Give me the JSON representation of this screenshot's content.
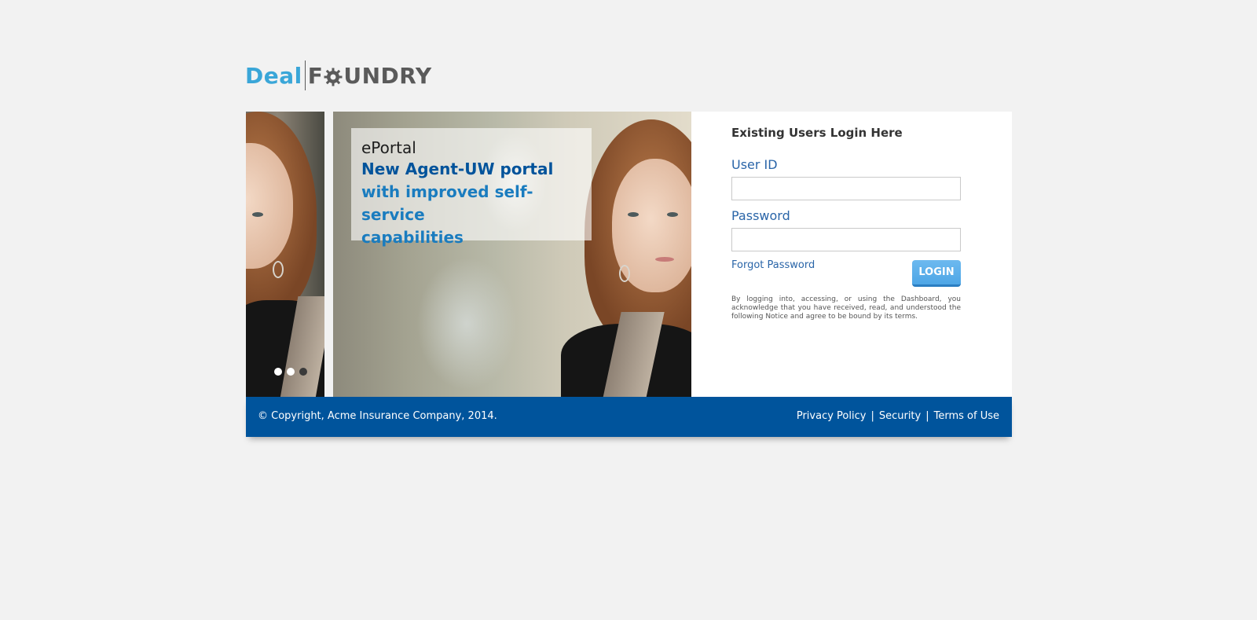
{
  "logo": {
    "part1": "Deal",
    "part2_prefix": "F",
    "part2_suffix": "UNDRY",
    "gear_icon": "gear-icon",
    "colors": {
      "deal": "#3aa6d8",
      "foundry": "#5a5a5a"
    }
  },
  "carousel": {
    "caption": {
      "title": "ePortal",
      "headline": "New Agent-UW portal",
      "subline1": "with improved self-service",
      "subline2": "capabilities"
    },
    "dots": [
      {
        "active": true
      },
      {
        "active": true
      },
      {
        "active": false
      }
    ]
  },
  "login": {
    "heading": "Existing Users Login Here",
    "user_id_label": "User ID",
    "user_id_value": "",
    "password_label": "Password",
    "password_value": "",
    "forgot_password": "Forgot Password",
    "login_button": "LOGIN",
    "notice": "By logging into, accessing, or using the Dashboard, you acknowledge that you have received, read, and understood the following Notice and agree to be bound by its terms."
  },
  "footer": {
    "copyright": "© Copyright, Acme Insurance Company, 2014.",
    "links": [
      "Privacy Policy",
      "Security",
      "Terms of Use"
    ],
    "separator": "|"
  },
  "colors": {
    "background": "#f2f2f2",
    "footer": "#00549c",
    "accent": "#2a65a8",
    "button": "#5aaeea"
  }
}
